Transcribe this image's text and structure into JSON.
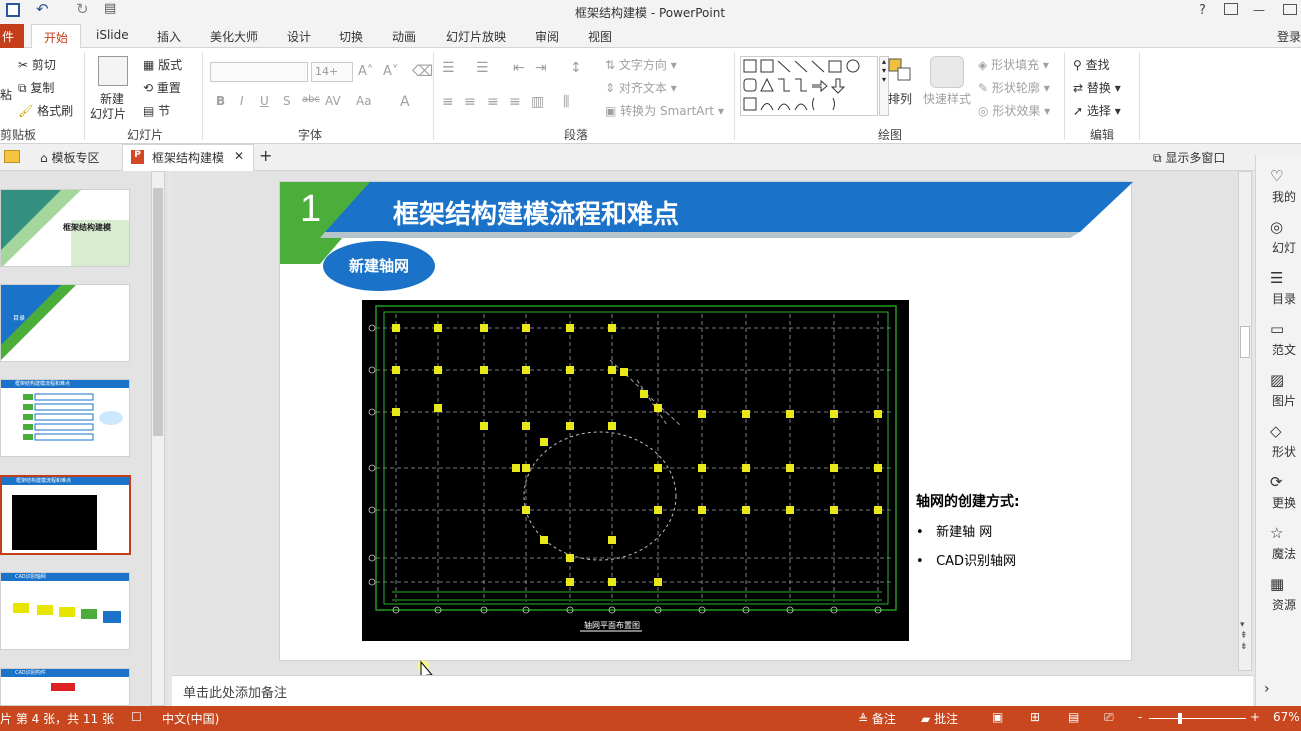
{
  "window": {
    "title": "框架结构建模 - PowerPoint",
    "help": "?",
    "minimize": "—"
  },
  "ribbon_tabs": [
    "件",
    "开始",
    "iSlide",
    "插入",
    "美化大师",
    "设计",
    "切换",
    "动画",
    "幻灯片放映",
    "审阅",
    "视图"
  ],
  "login": "登录",
  "clipboard": {
    "cut": "剪切",
    "copy": "复制",
    "format_painter": "格式刷",
    "paste": "粘",
    "label": "剪贴板"
  },
  "slides_group": {
    "new_slide": "新建",
    "new_slide2": "幻灯片",
    "layout": "版式",
    "reset": "重置",
    "section": "节",
    "label": "幻灯片"
  },
  "font_group": {
    "size": "14+",
    "label": "字体"
  },
  "paragraph_group": {
    "text_direction": "文字方向",
    "align_text": "对齐文本",
    "smartart": "转换为 SmartArt",
    "label": "段落"
  },
  "drawing_group": {
    "arrange": "排列",
    "quick_styles": "快速样式",
    "fill": "形状填充",
    "outline": "形状轮廓",
    "effects": "形状效果",
    "label": "绘图"
  },
  "editing_group": {
    "find": "查找",
    "replace": "替换",
    "select": "选择",
    "label": "编辑"
  },
  "doc_tabs": {
    "template": "模板专区",
    "current": "框架结构建模",
    "show_multi": "显示多窗口"
  },
  "thumbnails": [
    {
      "num": "",
      "title": "框架结构建模"
    },
    {
      "num": "",
      "title": "目录"
    },
    {
      "num": "1",
      "title": "框架结构建模流程和难点"
    },
    {
      "num": "1",
      "title": "框架结构建模流程和难点"
    },
    {
      "num": "2",
      "title": "CAD识别轴网"
    },
    {
      "num": "2",
      "title": "CAD识别构件"
    }
  ],
  "slide": {
    "number": "1",
    "title": "框架结构建模流程和难点",
    "badge": "新建轴网",
    "heading": "轴网的创建方式:",
    "bullets": [
      "新建轴 网",
      "CAD识别轴网"
    ],
    "drawing_caption": "轴网平面布置图"
  },
  "notes_placeholder": "单击此处添加备注",
  "right_panel": [
    "我的",
    "幻灯",
    "目录",
    "范文",
    "图片",
    "形状",
    "更换",
    "魔法",
    "资源"
  ],
  "status": {
    "slide_info": "片 第 4 张，共 11 张",
    "language": "中文(中国)",
    "notes": "备注",
    "comments": "批注",
    "zoom": "67%",
    "minus": "-",
    "plus": "+"
  },
  "colors": {
    "accent": "#c43e1c",
    "status_bar": "#c9471e",
    "slide_blue": "#1a73c9",
    "slide_green": "#4cae3a"
  }
}
